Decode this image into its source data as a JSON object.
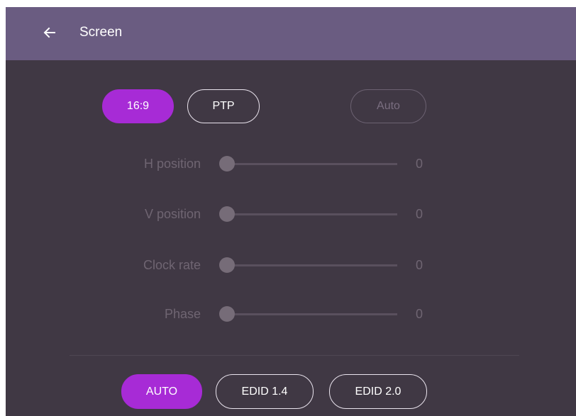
{
  "header": {
    "back_icon": "arrow-left-icon",
    "title": "Screen"
  },
  "aspect_buttons": {
    "ratio_16_9": "16:9",
    "ptp": "PTP",
    "auto": "Auto",
    "selected": "16:9"
  },
  "adjustments": [
    {
      "label": "H position",
      "value": "0"
    },
    {
      "label": "V position",
      "value": "0"
    },
    {
      "label": "Clock rate",
      "value": "0"
    },
    {
      "label": "Phase",
      "value": "0"
    }
  ],
  "edid_buttons": {
    "auto": "AUTO",
    "edid_1_4": "EDID 1.4",
    "edid_2_0": "EDID 2.0",
    "selected": "AUTO"
  },
  "colors": {
    "header_bg": "#6a5c81",
    "panel_bg": "#403844",
    "accent": "#a72bd6",
    "disabled_text": "#6f6572"
  }
}
